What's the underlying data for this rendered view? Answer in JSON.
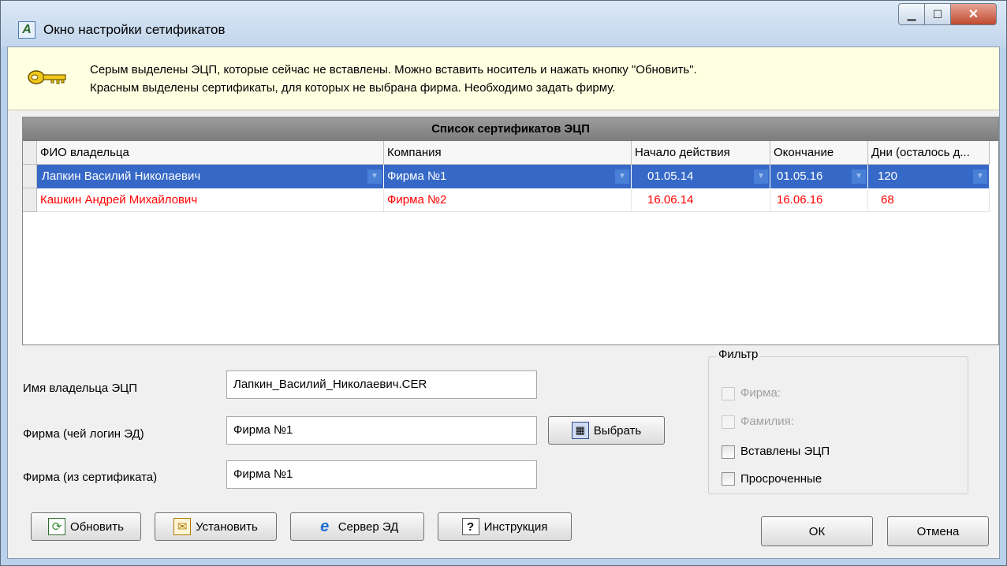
{
  "window": {
    "title": "Окно настройки сетификатов",
    "controls": [
      "minimize",
      "maximize",
      "close"
    ],
    "app_icon_glyph": "А"
  },
  "info": {
    "icon": "key-icon",
    "line1": "Серым выделены ЭЦП, которые сейчас не вставлены. Можно вставить носитель и нажать кнопку \"Обновить\".",
    "line2": "Красным выделены сертификаты, для которых не выбрана фирма. Необходимо задать фирму."
  },
  "grid": {
    "caption": "Список сертификатов ЭЦП",
    "columns": [
      "ФИО владельца",
      "Компания",
      "Начало действия",
      "Окончание",
      "Дни (осталось д..."
    ],
    "rows": [
      {
        "owner": "Лапкин  Василий  Николаевич",
        "company": "Фирма №1",
        "start": "01.05.14",
        "end": "01.05.16",
        "days": "120",
        "selected": true
      },
      {
        "owner": "Кашкин Андрей Михайлович",
        "company": "Фирма №2",
        "start": "16.06.14",
        "end": "16.06.16",
        "days": "68",
        "selected": false
      }
    ],
    "selected_color": "#3669c7",
    "warning_color": "#ff0000"
  },
  "form": {
    "owner_label": "Имя владельца ЭЦП",
    "owner_value": "Лапкин_Василий_Николаевич.CER",
    "firm_login_label": "Фирма (чей логин ЭД)",
    "firm_login_value": "Фирма №1",
    "firm_cert_label": "Фирма (из сертификата)",
    "firm_cert_value": "Фирма №1",
    "choose_label": "Выбрать"
  },
  "filter": {
    "title": "Фильтр",
    "items": [
      {
        "label": "Фирма:",
        "checked": false,
        "enabled": false
      },
      {
        "label": "Фамилия:",
        "checked": false,
        "enabled": false
      },
      {
        "label": "Вставлены ЭЦП",
        "checked": false,
        "enabled": true
      },
      {
        "label": "Просроченные",
        "checked": false,
        "enabled": true
      }
    ]
  },
  "buttons": {
    "refresh": "Обновить",
    "install": "Установить",
    "server": "Сервер ЭД",
    "help": "Инструкция",
    "ok": "ОК",
    "cancel": "Отмена"
  }
}
